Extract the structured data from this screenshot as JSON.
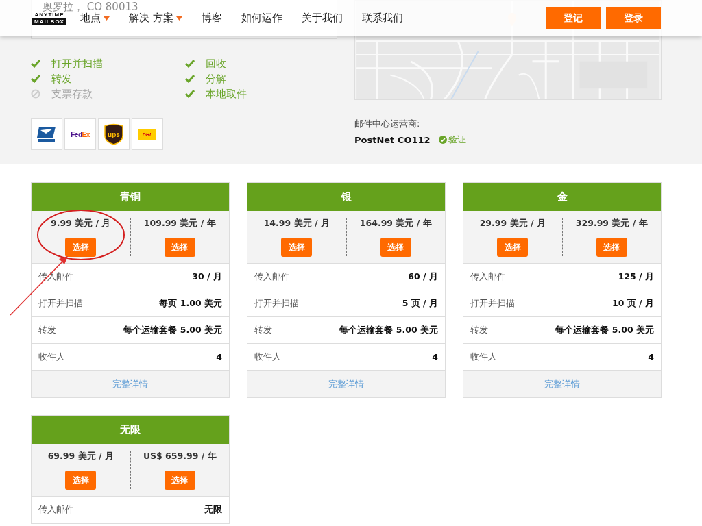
{
  "address": "奥罗拉， CO 80013",
  "header": {
    "logo_top": "ANYTIME",
    "logo_bottom": "MAILBOX",
    "nav": [
      {
        "label": "地点",
        "dropdown": true
      },
      {
        "label": "解决 方案",
        "dropdown": true
      },
      {
        "label": "博客",
        "dropdown": false
      },
      {
        "label": "如何运作",
        "dropdown": false
      },
      {
        "label": "关于我们",
        "dropdown": false
      },
      {
        "label": "联系我们",
        "dropdown": false
      }
    ],
    "buttons": [
      "登记",
      "登录"
    ]
  },
  "features": [
    {
      "label": "打开并扫描",
      "available": true
    },
    {
      "label": "转发",
      "available": true
    },
    {
      "label": "支票存款",
      "available": false
    },
    {
      "label": "回收",
      "available": true
    },
    {
      "label": "分解",
      "available": true
    },
    {
      "label": "本地取件",
      "available": true
    }
  ],
  "carriers": [
    {
      "kind": "usps"
    },
    {
      "kind": "fedex",
      "label_a": "Fed",
      "label_b": "Ex"
    },
    {
      "kind": "ups",
      "label": "ups"
    },
    {
      "kind": "dhl",
      "label": "DHL"
    }
  ],
  "operator": {
    "label": "邮件中心运营商:",
    "name": "PostNet CO112",
    "verified": "验证"
  },
  "plans": [
    {
      "name": "青铜",
      "prices": [
        {
          "price": "9.99 美元 / 月",
          "button": "选择"
        },
        {
          "price": "109.99 美元 / 年",
          "button": "选择"
        }
      ],
      "rows": [
        {
          "label": "传入邮件",
          "value": "30 / 月"
        },
        {
          "label": "打开并扫描",
          "value": "每页 1.00 美元"
        },
        {
          "label": "转发",
          "value": "每个运输套餐 5.00 美元"
        },
        {
          "label": "收件人",
          "value": "4"
        }
      ],
      "details": "完整详情",
      "annotated": true
    },
    {
      "name": "银",
      "prices": [
        {
          "price": "14.99 美元 / 月",
          "button": "选择"
        },
        {
          "price": "164.99 美元 / 年",
          "button": "选择"
        }
      ],
      "rows": [
        {
          "label": "传入邮件",
          "value": "60 / 月"
        },
        {
          "label": "打开并扫描",
          "value": "5 页 / 月"
        },
        {
          "label": "转发",
          "value": "每个运输套餐 5.00 美元"
        },
        {
          "label": "收件人",
          "value": "4"
        }
      ],
      "details": "完整详情",
      "annotated": false
    },
    {
      "name": "金",
      "prices": [
        {
          "price": "29.99 美元 / 月",
          "button": "选择"
        },
        {
          "price": "329.99 美元 / 年",
          "button": "选择"
        }
      ],
      "rows": [
        {
          "label": "传入邮件",
          "value": "125 / 月"
        },
        {
          "label": "打开并扫描",
          "value": "10 页 / 月"
        },
        {
          "label": "转发",
          "value": "每个运输套餐 5.00 美元"
        },
        {
          "label": "收件人",
          "value": "4"
        }
      ],
      "details": "完整详情",
      "annotated": false
    },
    {
      "name": "无限",
      "prices": [
        {
          "price": "69.99 美元 / 月",
          "button": "选择"
        },
        {
          "price": "US$ 659.99 / 年",
          "button": "选择"
        }
      ],
      "rows": [
        {
          "label": "传入邮件",
          "value": "无限"
        }
      ],
      "annotated": false
    }
  ]
}
